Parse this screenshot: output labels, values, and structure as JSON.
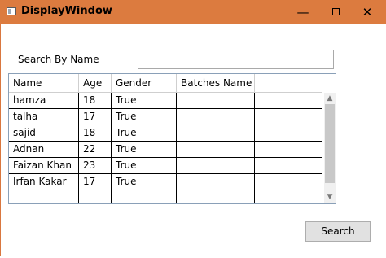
{
  "window": {
    "title": "DisplayWindow",
    "minimize_glyph": "—",
    "close_glyph": "✕"
  },
  "search": {
    "label": "Search By Name",
    "value": "",
    "placeholder": ""
  },
  "grid": {
    "columns": [
      "Name",
      "Age",
      "Gender",
      "Batches Name",
      ""
    ],
    "rows": [
      [
        "hamza",
        "18",
        "True",
        "",
        ""
      ],
      [
        "talha",
        "17",
        "True",
        "",
        ""
      ],
      [
        "sajid",
        "18",
        "True",
        "",
        ""
      ],
      [
        "Adnan",
        "22",
        "True",
        "",
        ""
      ],
      [
        "Faizan Khan",
        "23",
        "True",
        "",
        ""
      ],
      [
        "Irfan Kakar",
        "17",
        "True",
        "",
        ""
      ],
      [
        "",
        "",
        "",
        "",
        ""
      ]
    ],
    "scroll_up_glyph": "▲",
    "scroll_down_glyph": "▼"
  },
  "actions": {
    "search_label": "Search"
  }
}
